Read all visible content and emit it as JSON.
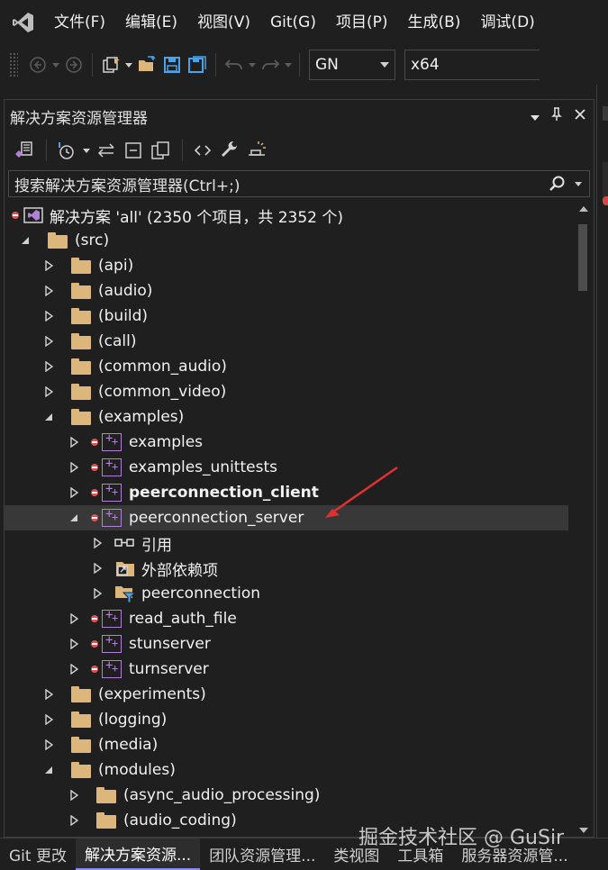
{
  "menu": [
    {
      "label": "文件(F)"
    },
    {
      "label": "编辑(E)"
    },
    {
      "label": "视图(V)"
    },
    {
      "label": "Git(G)"
    },
    {
      "label": "项目(P)"
    },
    {
      "label": "生成(B)"
    },
    {
      "label": "调试(D)"
    }
  ],
  "toolbar": {
    "config_combo": "GN",
    "platform_combo": "x64"
  },
  "panel": {
    "title": "解决方案资源管理器",
    "search_placeholder": "搜索解决方案资源管理器(Ctrl+;)"
  },
  "tree": [
    {
      "label": "解决方案 'all' (2350 个项目，共 2352 个)",
      "indent": 0,
      "icon": "solution-icon",
      "expander": "none",
      "status": "error"
    },
    {
      "label": "(src)",
      "indent": 1,
      "icon": "folder-icon",
      "expander": "expanded"
    },
    {
      "label": "(api)",
      "indent": 2,
      "icon": "folder-icon",
      "expander": "collapsed"
    },
    {
      "label": "(audio)",
      "indent": 2,
      "icon": "folder-icon",
      "expander": "collapsed"
    },
    {
      "label": "(build)",
      "indent": 2,
      "icon": "folder-icon",
      "expander": "collapsed"
    },
    {
      "label": "(call)",
      "indent": 2,
      "icon": "folder-icon",
      "expander": "collapsed"
    },
    {
      "label": "(common_audio)",
      "indent": 2,
      "icon": "folder-icon",
      "expander": "collapsed"
    },
    {
      "label": "(common_video)",
      "indent": 2,
      "icon": "folder-icon",
      "expander": "collapsed"
    },
    {
      "label": "(examples)",
      "indent": 2,
      "icon": "folder-icon",
      "expander": "expanded"
    },
    {
      "label": "examples",
      "indent": 3,
      "icon": "cpp-project-icon",
      "expander": "collapsed",
      "status": "error"
    },
    {
      "label": "examples_unittests",
      "indent": 3,
      "icon": "cpp-project-icon",
      "expander": "collapsed",
      "status": "error"
    },
    {
      "label": "peerconnection_client",
      "indent": 3,
      "icon": "cpp-project-icon",
      "expander": "collapsed",
      "status": "error",
      "bold": true
    },
    {
      "label": "peerconnection_server",
      "indent": 3,
      "icon": "cpp-project-icon",
      "expander": "expanded",
      "status": "error",
      "selected": true
    },
    {
      "label": "引用",
      "indent": 4,
      "icon": "references-icon",
      "expander": "collapsed"
    },
    {
      "label": "外部依赖项",
      "indent": 4,
      "icon": "external-dependencies-icon",
      "expander": "collapsed"
    },
    {
      "label": "peerconnection",
      "indent": 4,
      "icon": "filter-folder-icon",
      "expander": "collapsed"
    },
    {
      "label": "read_auth_file",
      "indent": 3,
      "icon": "cpp-project-icon",
      "expander": "collapsed",
      "status": "error"
    },
    {
      "label": "stunserver",
      "indent": 3,
      "icon": "cpp-project-icon",
      "expander": "collapsed",
      "status": "error"
    },
    {
      "label": "turnserver",
      "indent": 3,
      "icon": "cpp-project-icon",
      "expander": "collapsed",
      "status": "error"
    },
    {
      "label": "(experiments)",
      "indent": 2,
      "icon": "folder-icon",
      "expander": "collapsed"
    },
    {
      "label": "(logging)",
      "indent": 2,
      "icon": "folder-icon",
      "expander": "collapsed"
    },
    {
      "label": "(media)",
      "indent": 2,
      "icon": "folder-icon",
      "expander": "collapsed"
    },
    {
      "label": "(modules)",
      "indent": 2,
      "icon": "folder-icon",
      "expander": "expanded"
    },
    {
      "label": "(async_audio_processing)",
      "indent": 3,
      "icon": "folder-icon",
      "expander": "collapsed"
    },
    {
      "label": "(audio_coding)",
      "indent": 3,
      "icon": "folder-icon",
      "expander": "collapsed"
    }
  ],
  "bottom_tabs": [
    {
      "label": "Git 更改",
      "active": false
    },
    {
      "label": "解决方案资源...",
      "active": true
    },
    {
      "label": "团队资源管理...",
      "active": false
    },
    {
      "label": "类视图",
      "active": false
    },
    {
      "label": "工具箱",
      "active": false
    },
    {
      "label": "服务器资源管...",
      "active": false
    }
  ],
  "watermark": "掘金技术社区 @ GuSir",
  "colors": {
    "background": "#1f1f1f",
    "folder": "#dcb67a",
    "project": "#b180d7",
    "error": "#e05252",
    "selection": "#383838",
    "save_icon": "#4aa3e8",
    "open_icon": "#dcb67a",
    "annotation_arrow": "#e03030"
  }
}
